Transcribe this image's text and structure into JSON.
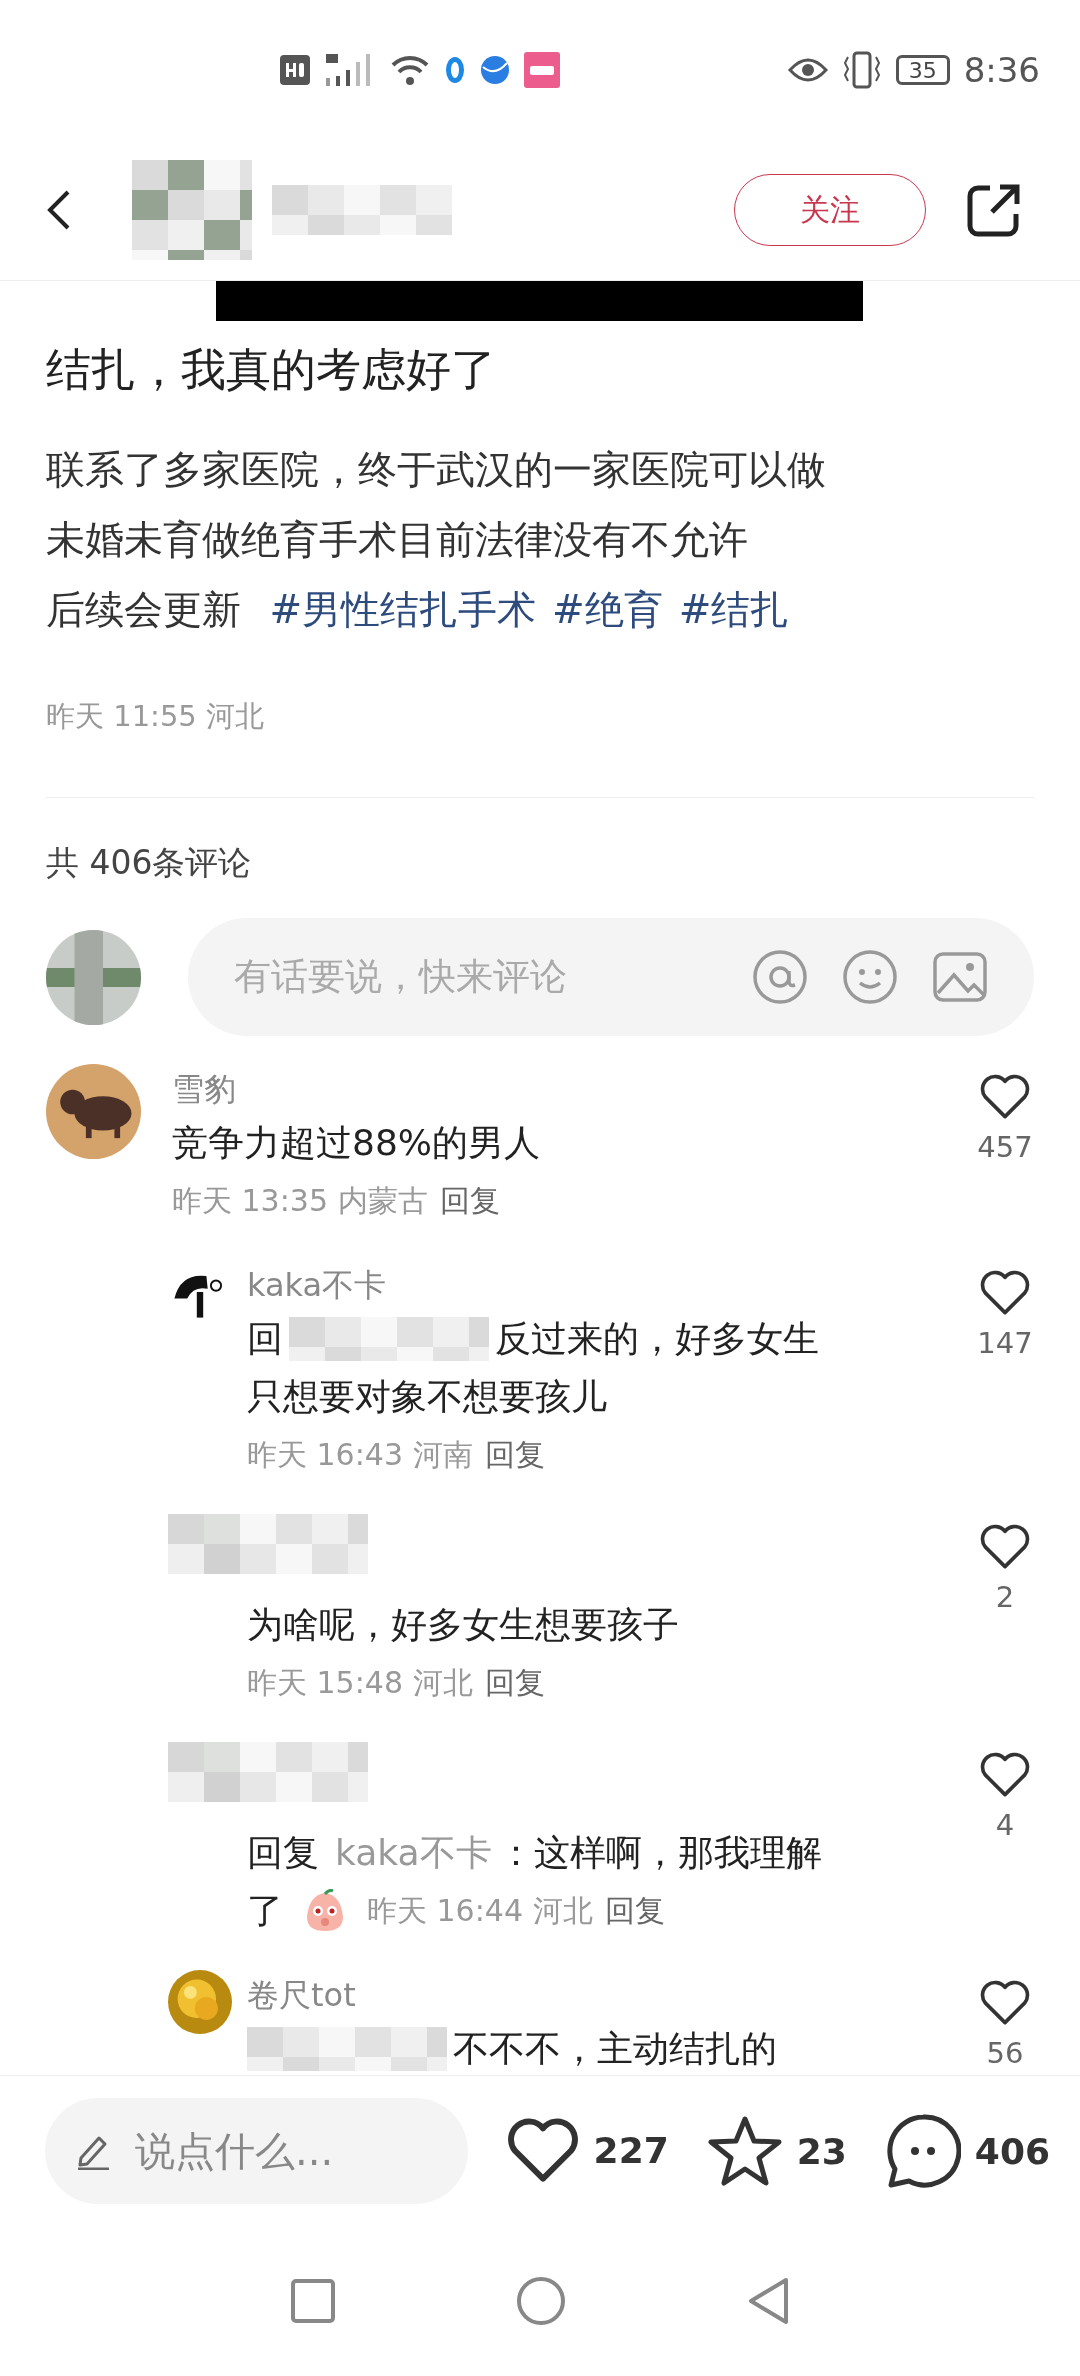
{
  "status_bar": {
    "battery": "35",
    "time": "8:36"
  },
  "header": {
    "follow_button": "关注"
  },
  "post": {
    "title": "结扎，我真的考虑好了",
    "lines": [
      "联系了多家医院，终于武汉的一家医院可以做",
      "未婚未育做绝育手术目前法律没有不允许"
    ],
    "tail": "后续会更新",
    "hashtags": [
      "#男性结扎手术",
      "#绝育",
      "#结扎"
    ],
    "meta": "昨天 11:55 河北"
  },
  "comments_count": "共 406条评论",
  "comment_input": {
    "placeholder": "有话要说，快来评论"
  },
  "comments": [
    {
      "kind": "comment",
      "avatar": {
        "kind": "picture"
      },
      "name": "雪豹",
      "likes": "457",
      "lines": [
        [
          {
            "kind": "text",
            "text": "竞争力超过88%的男人"
          }
        ],
        [
          {
            "kind": "meta",
            "text": "昨天 13:35 内蒙古"
          },
          {
            "kind": "reply",
            "text": "回复"
          }
        ]
      ]
    },
    {
      "kind": "reply",
      "avatar": {
        "kind": "picture"
      },
      "name": "kaka不卡",
      "likes": "147",
      "lines": [
        [
          {
            "kind": "text",
            "text": "回"
          },
          {
            "kind": "blur"
          },
          {
            "kind": "text",
            "text": "反过来的，好多女生"
          }
        ],
        [
          {
            "kind": "text",
            "text": "只想要对象不想要孩儿"
          }
        ],
        [
          {
            "kind": "meta",
            "text": "昨天 16:43 河南"
          },
          {
            "kind": "reply",
            "text": "回复"
          }
        ]
      ]
    },
    {
      "kind": "reply",
      "avatar": {
        "kind": "blurred"
      },
      "likes": "2",
      "lines": [
        [
          {
            "kind": "text",
            "text": "为啥呢，好多女生想要孩子"
          }
        ],
        [
          {
            "kind": "meta",
            "text": "昨天 15:48 河北"
          },
          {
            "kind": "reply",
            "text": "回复"
          }
        ]
      ]
    },
    {
      "kind": "reply",
      "avatar": {
        "kind": "blurred"
      },
      "likes": "4",
      "lines": [
        [
          {
            "kind": "text",
            "text": "回复"
          },
          {
            "kind": "mention",
            "text": "kaka不卡"
          },
          {
            "kind": "text",
            "text": "：这样啊，那我理解"
          }
        ],
        [
          {
            "kind": "text",
            "text": "了"
          },
          {
            "kind": "sticker"
          },
          {
            "kind": "meta",
            "text": "昨天 16:44 河北"
          },
          {
            "kind": "reply",
            "text": "回复"
          }
        ]
      ]
    },
    {
      "kind": "reply",
      "avatar": {
        "kind": "picture"
      },
      "name": "卷尺tot",
      "likes": "56",
      "lines": [
        [
          {
            "kind": "blur"
          },
          {
            "kind": "text",
            "text": "不不不，主动结扎的"
          }
        ]
      ]
    }
  ],
  "bottom_bar": {
    "placeholder": "说点什么...",
    "likes": "227",
    "stars": "23",
    "comments": "406"
  }
}
